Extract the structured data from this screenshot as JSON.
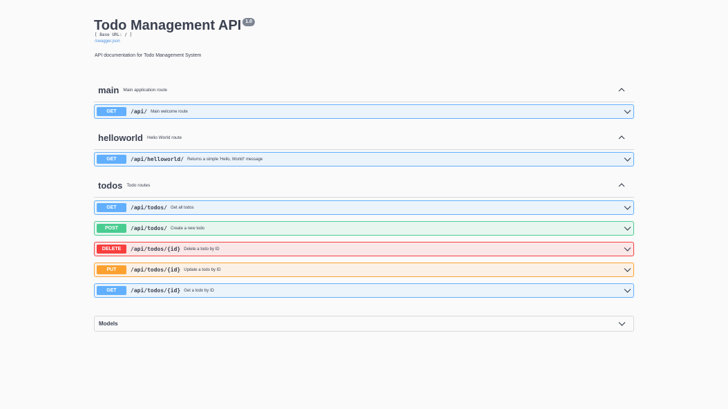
{
  "info": {
    "title": "Todo Management API",
    "version": "1.0",
    "base_url": "[ Base URL: / ]",
    "spec_link": "/swagger.json",
    "description": "API documentation for Todo Management System"
  },
  "icons": {
    "collapse": "chevron-up-icon",
    "expand": "chevron-down-icon"
  },
  "colors": {
    "get": "#61affe",
    "post": "#49cc90",
    "delete": "#f93e3e",
    "put": "#fca130"
  },
  "tags": [
    {
      "name": "main",
      "description": "Main application route",
      "operations": [
        {
          "method": "GET",
          "path": "/api/",
          "summary": "Main welcome route"
        }
      ]
    },
    {
      "name": "helloworld",
      "description": "Hello World route",
      "operations": [
        {
          "method": "GET",
          "path": "/api/helloworld/",
          "summary": "Returns a simple 'Hello, World!' message"
        }
      ]
    },
    {
      "name": "todos",
      "description": "Todo routes",
      "operations": [
        {
          "method": "GET",
          "path": "/api/todos/",
          "summary": "Get all todos"
        },
        {
          "method": "POST",
          "path": "/api/todos/",
          "summary": "Create a new todo"
        },
        {
          "method": "DELETE",
          "path": "/api/todos/{id}",
          "summary": "Delete a todo by ID"
        },
        {
          "method": "PUT",
          "path": "/api/todos/{id}",
          "summary": "Update a todo by ID"
        },
        {
          "method": "GET",
          "path": "/api/todos/{id}",
          "summary": "Get a todo by ID"
        }
      ]
    }
  ],
  "models": {
    "title": "Models"
  }
}
